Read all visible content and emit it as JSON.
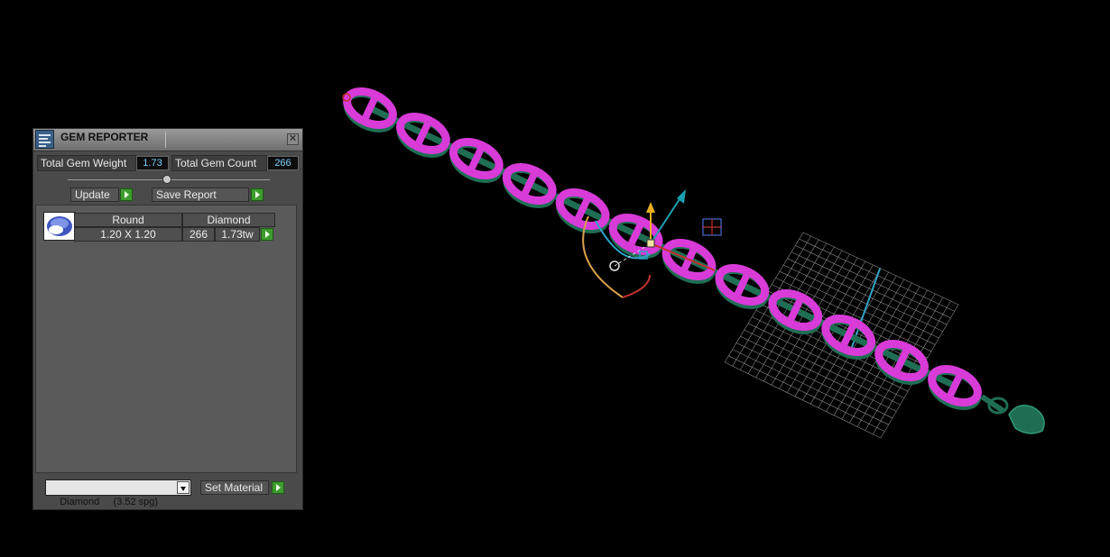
{
  "panel": {
    "title": "GEM REPORTER",
    "total_weight_label": "Total Gem Weight",
    "total_weight_value": "1.73",
    "total_count_label": "Total Gem Count",
    "total_count_value": "266",
    "update_label": "Update",
    "save_report_label": "Save Report",
    "gem_rows": [
      {
        "shape": "Round",
        "material": "Diamond",
        "size": "1.20 X 1.20",
        "count": "266",
        "weight": "1.73tw"
      }
    ],
    "material_select": {
      "selected": "Diamond     (3.52 spg)"
    },
    "set_material_label": "Set Material"
  },
  "icons": {
    "title": "gem-reporter-icon",
    "close": "close-icon",
    "gem": "round-gem-icon"
  },
  "colors": {
    "link_gem": "#d83bd8",
    "link_metal": "#1f6e54",
    "value_text": "#7fd0ff",
    "go_button": "#3e9b2e"
  }
}
